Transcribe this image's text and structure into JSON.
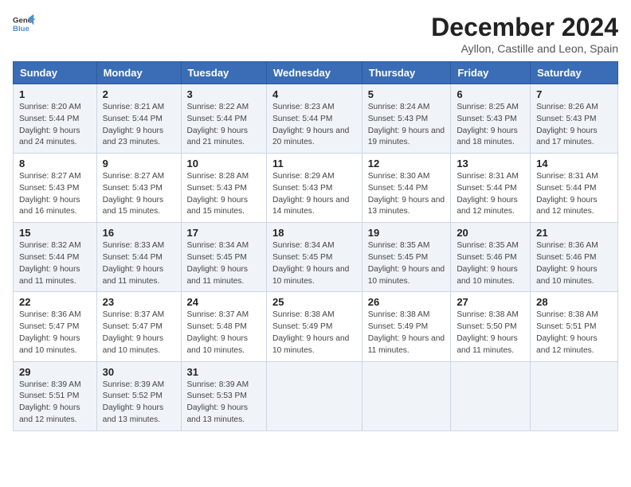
{
  "header": {
    "logo_line1": "General",
    "logo_line2": "Blue",
    "title": "December 2024",
    "subtitle": "Ayllon, Castille and Leon, Spain"
  },
  "columns": [
    "Sunday",
    "Monday",
    "Tuesday",
    "Wednesday",
    "Thursday",
    "Friday",
    "Saturday"
  ],
  "weeks": [
    [
      {
        "day": "1",
        "sunrise": "8:20 AM",
        "sunset": "5:44 PM",
        "daylight": "9 hours and 24 minutes."
      },
      {
        "day": "2",
        "sunrise": "8:21 AM",
        "sunset": "5:44 PM",
        "daylight": "9 hours and 23 minutes."
      },
      {
        "day": "3",
        "sunrise": "8:22 AM",
        "sunset": "5:44 PM",
        "daylight": "9 hours and 21 minutes."
      },
      {
        "day": "4",
        "sunrise": "8:23 AM",
        "sunset": "5:44 PM",
        "daylight": "9 hours and 20 minutes."
      },
      {
        "day": "5",
        "sunrise": "8:24 AM",
        "sunset": "5:43 PM",
        "daylight": "9 hours and 19 minutes."
      },
      {
        "day": "6",
        "sunrise": "8:25 AM",
        "sunset": "5:43 PM",
        "daylight": "9 hours and 18 minutes."
      },
      {
        "day": "7",
        "sunrise": "8:26 AM",
        "sunset": "5:43 PM",
        "daylight": "9 hours and 17 minutes."
      }
    ],
    [
      {
        "day": "8",
        "sunrise": "8:27 AM",
        "sunset": "5:43 PM",
        "daylight": "9 hours and 16 minutes."
      },
      {
        "day": "9",
        "sunrise": "8:27 AM",
        "sunset": "5:43 PM",
        "daylight": "9 hours and 15 minutes."
      },
      {
        "day": "10",
        "sunrise": "8:28 AM",
        "sunset": "5:43 PM",
        "daylight": "9 hours and 15 minutes."
      },
      {
        "day": "11",
        "sunrise": "8:29 AM",
        "sunset": "5:43 PM",
        "daylight": "9 hours and 14 minutes."
      },
      {
        "day": "12",
        "sunrise": "8:30 AM",
        "sunset": "5:44 PM",
        "daylight": "9 hours and 13 minutes."
      },
      {
        "day": "13",
        "sunrise": "8:31 AM",
        "sunset": "5:44 PM",
        "daylight": "9 hours and 12 minutes."
      },
      {
        "day": "14",
        "sunrise": "8:31 AM",
        "sunset": "5:44 PM",
        "daylight": "9 hours and 12 minutes."
      }
    ],
    [
      {
        "day": "15",
        "sunrise": "8:32 AM",
        "sunset": "5:44 PM",
        "daylight": "9 hours and 11 minutes."
      },
      {
        "day": "16",
        "sunrise": "8:33 AM",
        "sunset": "5:44 PM",
        "daylight": "9 hours and 11 minutes."
      },
      {
        "day": "17",
        "sunrise": "8:34 AM",
        "sunset": "5:45 PM",
        "daylight": "9 hours and 11 minutes."
      },
      {
        "day": "18",
        "sunrise": "8:34 AM",
        "sunset": "5:45 PM",
        "daylight": "9 hours and 10 minutes."
      },
      {
        "day": "19",
        "sunrise": "8:35 AM",
        "sunset": "5:45 PM",
        "daylight": "9 hours and 10 minutes."
      },
      {
        "day": "20",
        "sunrise": "8:35 AM",
        "sunset": "5:46 PM",
        "daylight": "9 hours and 10 minutes."
      },
      {
        "day": "21",
        "sunrise": "8:36 AM",
        "sunset": "5:46 PM",
        "daylight": "9 hours and 10 minutes."
      }
    ],
    [
      {
        "day": "22",
        "sunrise": "8:36 AM",
        "sunset": "5:47 PM",
        "daylight": "9 hours and 10 minutes."
      },
      {
        "day": "23",
        "sunrise": "8:37 AM",
        "sunset": "5:47 PM",
        "daylight": "9 hours and 10 minutes."
      },
      {
        "day": "24",
        "sunrise": "8:37 AM",
        "sunset": "5:48 PM",
        "daylight": "9 hours and 10 minutes."
      },
      {
        "day": "25",
        "sunrise": "8:38 AM",
        "sunset": "5:49 PM",
        "daylight": "9 hours and 10 minutes."
      },
      {
        "day": "26",
        "sunrise": "8:38 AM",
        "sunset": "5:49 PM",
        "daylight": "9 hours and 11 minutes."
      },
      {
        "day": "27",
        "sunrise": "8:38 AM",
        "sunset": "5:50 PM",
        "daylight": "9 hours and 11 minutes."
      },
      {
        "day": "28",
        "sunrise": "8:38 AM",
        "sunset": "5:51 PM",
        "daylight": "9 hours and 12 minutes."
      }
    ],
    [
      {
        "day": "29",
        "sunrise": "8:39 AM",
        "sunset": "5:51 PM",
        "daylight": "9 hours and 12 minutes."
      },
      {
        "day": "30",
        "sunrise": "8:39 AM",
        "sunset": "5:52 PM",
        "daylight": "9 hours and 13 minutes."
      },
      {
        "day": "31",
        "sunrise": "8:39 AM",
        "sunset": "5:53 PM",
        "daylight": "9 hours and 13 minutes."
      },
      null,
      null,
      null,
      null
    ]
  ],
  "labels": {
    "sunrise": "Sunrise:",
    "sunset": "Sunset:",
    "daylight": "Daylight:"
  }
}
